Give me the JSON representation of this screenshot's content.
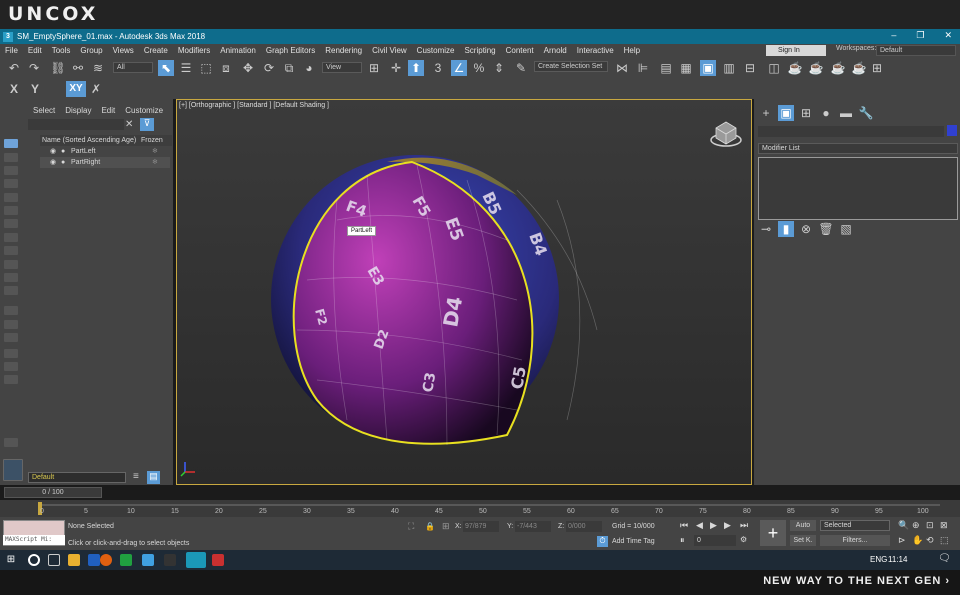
{
  "brand": "UNCOX",
  "slogan": "NEW WAY TO THE NEXT GEN ›",
  "window": {
    "title": "SM_EmptySphere_01.max - Autodesk 3ds Max 2018",
    "app_icon": "3"
  },
  "menu": [
    "File",
    "Edit",
    "Tools",
    "Group",
    "Views",
    "Create",
    "Modifiers",
    "Animation",
    "Graph Editors",
    "Rendering",
    "Civil View",
    "Customize",
    "Scripting",
    "Content",
    "Arnold",
    "Interactive",
    "Help"
  ],
  "account": {
    "sign_in": "Sign In",
    "workspaces_label": "Workspaces:",
    "workspace": "Default"
  },
  "toolbar": {
    "filter": "All",
    "view": "View",
    "create_selection_set": "Create Selection Set",
    "axes": [
      "X",
      "Y",
      "XY"
    ]
  },
  "explorer": {
    "tabs": [
      "Select",
      "Display",
      "Edit",
      "Customize"
    ],
    "col_name": "Name (Sorted Ascending Age)",
    "col_frozen": "Frozen",
    "rows": [
      "PartLeft",
      "PartRight"
    ],
    "layer": "Default"
  },
  "viewport": {
    "label": "[+] [Orthographic ] [Standard ] [Default Shading ]",
    "tooltip": "PartLeft"
  },
  "sphere_labels": [
    "F4",
    "F5",
    "E5",
    "D4",
    "E3",
    "D2",
    "C3",
    "C5",
    "B4",
    "B5",
    "F2",
    "D4"
  ],
  "command_panel": {
    "modifier_list": "Modifier List"
  },
  "time": {
    "frame": "0 / 100",
    "ticks": [
      "0",
      "5",
      "10",
      "15",
      "20",
      "25",
      "30",
      "35",
      "40",
      "45",
      "50",
      "55",
      "60",
      "65",
      "70",
      "75",
      "80",
      "85",
      "90",
      "95",
      "100"
    ]
  },
  "status": {
    "selection": "None Selected",
    "prompt": "Click or click-and-drag to select objects",
    "maxscript": "MAXScript Mi:",
    "x_label": "X:",
    "x_value": "97/879",
    "y_label": "Y:",
    "y_value": "-7/443",
    "z_label": "Z:",
    "z_value": "0/000",
    "grid": "Grid = 10/000",
    "add_time_tag": "Add Time Tag",
    "frame_value": "0",
    "auto": "Auto",
    "set_key": "Set K.",
    "selected": "Selected",
    "filters": "Filters..."
  },
  "taskbar": {
    "lang": "ENG",
    "time": "11:14"
  }
}
